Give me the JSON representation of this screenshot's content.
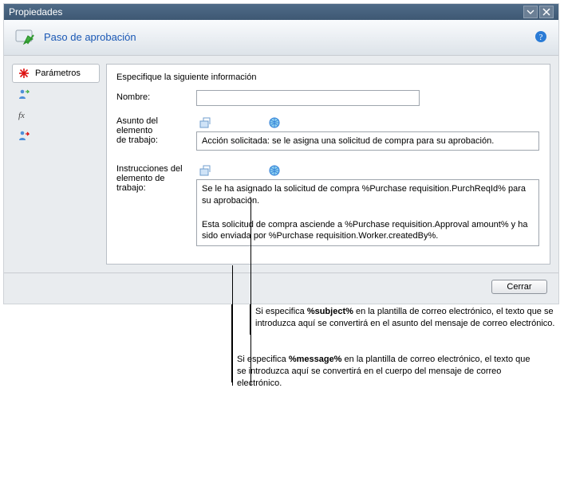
{
  "window": {
    "title": "Propiedades"
  },
  "header": {
    "step_title": "Paso de aprobación"
  },
  "tabs": {
    "parameters": "Parámetros"
  },
  "form": {
    "intro": "Especifique la siguiente información",
    "name_label": "Nombre:",
    "name_value": "",
    "subject_label_l1": "Asunto del elemento",
    "subject_label_l2": "de trabajo:",
    "subject_value": "Acción solicitada: se le asigna una solicitud de compra para su aprobación.",
    "instructions_label_l1": "Instrucciones del",
    "instructions_label_l2": "elemento de trabajo:",
    "instructions_value": "Se le ha asignado la solicitud de compra %Purchase requisition.PurchReqId% para su aprobación.\n\nEsta solicitud de compra asciende a %Purchase requisition.Approval amount% y ha sido enviada por %Purchase requisition.Worker.createdBy%."
  },
  "buttons": {
    "close": "Cerrar"
  },
  "annotations": {
    "subject_pre": "Si especifica ",
    "subject_token": "%subject%",
    "subject_post": " en la plantilla de correo electrónico, el texto que se introduzca aquí se convertirá en el asunto del mensaje de correo electrónico.",
    "message_pre": "Si especifica ",
    "message_token": "%message%",
    "message_post": " en la plantilla de correo electrónico, el texto que se introduzca aquí se convertirá en el cuerpo del mensaje de correo electrónico."
  }
}
